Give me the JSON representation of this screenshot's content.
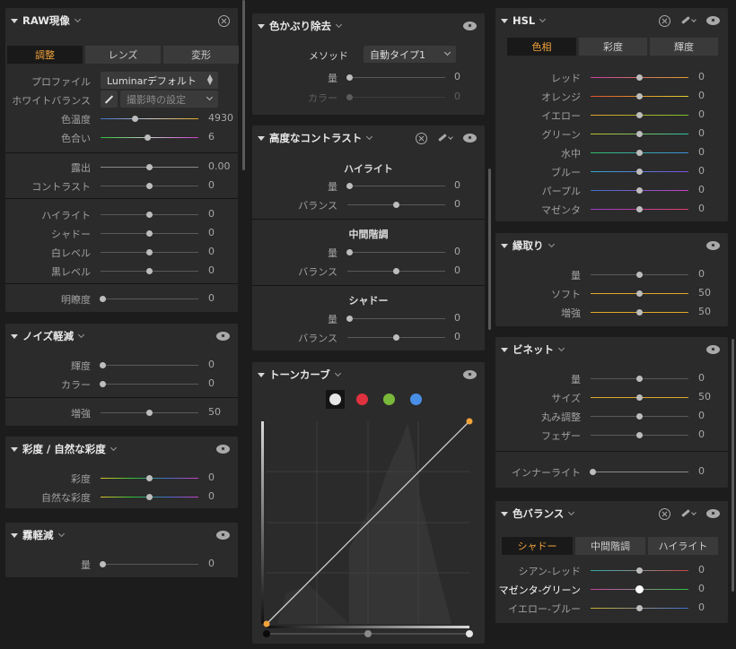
{
  "raw": {
    "title": "RAW現像",
    "tabs": [
      "調整",
      "レンズ",
      "変形"
    ],
    "profile_label": "プロファイル",
    "profile_value": "Luminarデフォルト",
    "wb_label": "ホワイトバランス",
    "wb_value": "撮影時の設定",
    "temp": {
      "label": "色温度",
      "value": "4930"
    },
    "tint": {
      "label": "色合い",
      "value": "6"
    },
    "exposure": {
      "label": "露出",
      "value": "0.00"
    },
    "contrast": {
      "label": "コントラスト",
      "value": "0"
    },
    "highlights": {
      "label": "ハイライト",
      "value": "0"
    },
    "shadows": {
      "label": "シャドー",
      "value": "0"
    },
    "whites": {
      "label": "白レベル",
      "value": "0"
    },
    "blacks": {
      "label": "黒レベル",
      "value": "0"
    },
    "clarity": {
      "label": "明瞭度",
      "value": "0"
    }
  },
  "noise": {
    "title": "ノイズ軽減",
    "luma": {
      "label": "輝度",
      "value": "0"
    },
    "color": {
      "label": "カラー",
      "value": "0"
    },
    "boost": {
      "label": "増強",
      "value": "50"
    }
  },
  "saturation": {
    "title": "彩度 / 自然な彩度",
    "sat": {
      "label": "彩度",
      "value": "0"
    },
    "vib": {
      "label": "自然な彩度",
      "value": "0"
    }
  },
  "dehaze": {
    "title": "霧軽減",
    "amount": {
      "label": "量",
      "value": "0"
    }
  },
  "colorcast": {
    "title": "色かぶり除去",
    "method_label": "メソッド",
    "method_value": "自動タイプ1",
    "amount": {
      "label": "量",
      "value": "0"
    },
    "color": {
      "label": "カラー",
      "value": "0"
    }
  },
  "advcontrast": {
    "title": "高度なコントラスト",
    "highlights_title": "ハイライト",
    "midtones_title": "中間階調",
    "shadows_title": "シャドー",
    "amount_label": "量",
    "balance_label": "バランス",
    "h_amount": "0",
    "h_balance": "0",
    "m_amount": "0",
    "m_balance": "0",
    "s_amount": "0",
    "s_balance": "0"
  },
  "tonecurve": {
    "title": "トーンカーブ",
    "channels": [
      "white",
      "red",
      "green",
      "blue"
    ]
  },
  "hsl": {
    "title": "HSL",
    "tabs": [
      "色相",
      "彩度",
      "輝度"
    ],
    "rows": [
      {
        "label": "レッド",
        "value": "0"
      },
      {
        "label": "オレンジ",
        "value": "0"
      },
      {
        "label": "イエロー",
        "value": "0"
      },
      {
        "label": "グリーン",
        "value": "0"
      },
      {
        "label": "水中",
        "value": "0"
      },
      {
        "label": "ブルー",
        "value": "0"
      },
      {
        "label": "パープル",
        "value": "0"
      },
      {
        "label": "マゼンタ",
        "value": "0"
      }
    ]
  },
  "edge": {
    "title": "縁取り",
    "amount": {
      "label": "量",
      "value": "0"
    },
    "soft": {
      "label": "ソフト",
      "value": "50"
    },
    "boost": {
      "label": "増強",
      "value": "50"
    }
  },
  "vignette": {
    "title": "ビネット",
    "amount": {
      "label": "量",
      "value": "0"
    },
    "size": {
      "label": "サイズ",
      "value": "50"
    },
    "roundness": {
      "label": "丸み調整",
      "value": "0"
    },
    "feather": {
      "label": "フェザー",
      "value": "0"
    },
    "inner": {
      "label": "インナーライト",
      "value": "0"
    }
  },
  "colorbal": {
    "title": "色バランス",
    "tabs": [
      "シャドー",
      "中間階調",
      "ハイライト"
    ],
    "cr": {
      "label": "シアン-レッド",
      "value": "0"
    },
    "mg": {
      "label": "マゼンタ-グリーン",
      "value": "0"
    },
    "yb": {
      "label": "イエロー-ブルー",
      "value": "0"
    }
  },
  "colors": {
    "accent": "#f0a23a",
    "panel": "#2b2b2b",
    "bg": "#1c1c1c"
  }
}
